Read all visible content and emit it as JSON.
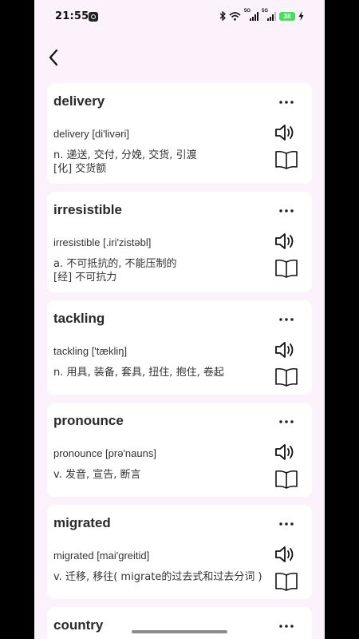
{
  "status_bar": {
    "time": "21:55",
    "battery": "38",
    "sim1": "5G",
    "sim2": "5G"
  },
  "words": [
    {
      "title": "delivery",
      "pronunciation": "delivery [di'livəri]",
      "definitions": [
        "n. 递送, 交付, 分娩, 交货, 引渡",
        "[化] 交货额"
      ]
    },
    {
      "title": "irresistible",
      "pronunciation": "irresistible [.iri'zistəbl]",
      "definitions": [
        "a. 不可抵抗的, 不能压制的",
        "[经] 不可抗力"
      ]
    },
    {
      "title": "tackling",
      "pronunciation": "tackling ['tækliŋ]",
      "definitions": [
        "n. 用具, 装备, 套具, 扭住, 抱住, 卷起"
      ]
    },
    {
      "title": "pronounce",
      "pronunciation": "pronounce [prə'nauns]",
      "definitions": [
        "v. 发音, 宣告, 断言"
      ]
    },
    {
      "title": "migrated",
      "pronunciation": "migrated [mai'greitid]",
      "definitions": [
        "v. 迁移, 移往( migrate的过去式和过去分词 )"
      ]
    },
    {
      "title": "country",
      "pronunciation": "",
      "definitions": []
    }
  ],
  "icons": {
    "back": "back-arrow-icon",
    "more": "more-dots-icon",
    "speaker": "speaker-icon",
    "book": "book-icon"
  },
  "colors": {
    "background": "#fbf2fb",
    "card": "#ffffff",
    "text": "#2a2a2a",
    "battery": "#4cd964"
  }
}
